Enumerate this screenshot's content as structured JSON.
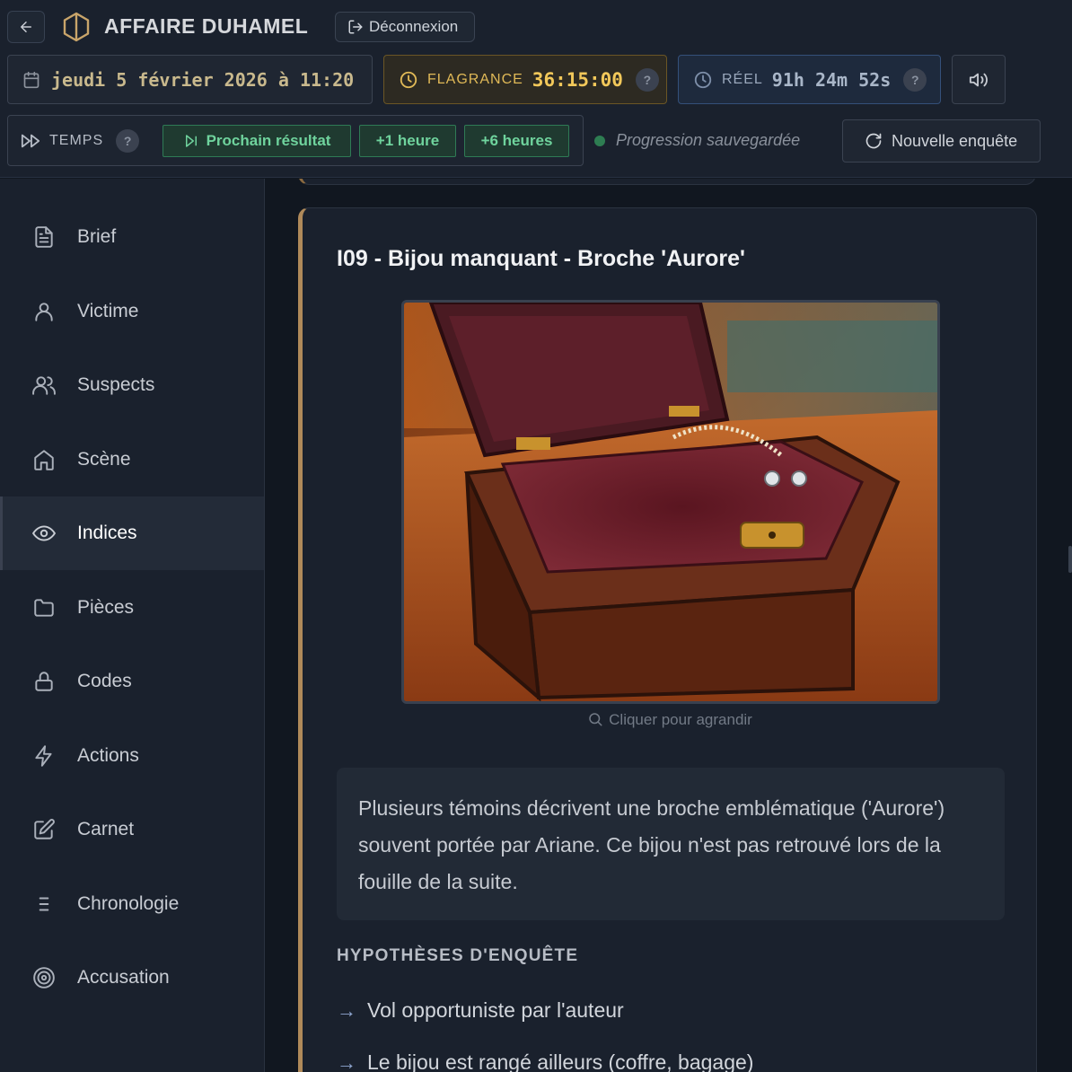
{
  "header": {
    "back_label": "←",
    "title": "AFFAIRE DUHAMEL",
    "logout_label": "Déconnexion"
  },
  "clock": {
    "date": "jeudi 5 février 2026 à 11:20",
    "flagrance_label": "FLAGRANCE",
    "flagrance_value": "36:15:00",
    "real_label": "RÉEL",
    "real_value": "91h 24m 52s",
    "help": "?"
  },
  "time_controls": {
    "label": "TEMPS",
    "help": "?",
    "next_result": "Prochain résultat",
    "plus_1h": "+1 heure",
    "plus_6h": "+6 heures"
  },
  "status": {
    "saved": "Progression sauvegardée"
  },
  "new_investigation": "Nouvelle enquête",
  "sidebar": {
    "items": [
      {
        "label": "Brief",
        "icon": "file-text-icon"
      },
      {
        "label": "Victime",
        "icon": "user-icon"
      },
      {
        "label": "Suspects",
        "icon": "users-icon"
      },
      {
        "label": "Scène",
        "icon": "home-icon"
      },
      {
        "label": "Indices",
        "icon": "eye-icon",
        "active": true
      },
      {
        "label": "Pièces",
        "icon": "folder-icon"
      },
      {
        "label": "Codes",
        "icon": "lock-icon"
      },
      {
        "label": "Actions",
        "icon": "lightning-icon"
      },
      {
        "label": "Carnet",
        "icon": "edit-icon"
      },
      {
        "label": "Chronologie",
        "icon": "list-icon"
      },
      {
        "label": "Accusation",
        "icon": "target-icon"
      }
    ]
  },
  "clue": {
    "title": "I09 - Bijou manquant - Broche 'Aurore'",
    "enlarge_hint": "Cliquer pour agrandir",
    "description": "Plusieurs témoins décrivent une broche emblématique ('Aurore') souvent portée par Ariane. Ce bijou n'est pas retrouvé lors de la fouille de la suite.",
    "hypotheses_title": "HYPOTHÈSES D'ENQUÊTE",
    "hypotheses": [
      "Vol opportuniste par l'auteur",
      "Le bijou est rangé ailleurs (coffre, bagage)"
    ]
  },
  "colors": {
    "accent_gold": "#f2c85a",
    "accent_green": "#6fd39d",
    "accent_blue": "#34507a",
    "card_border": "#b08a5a"
  }
}
